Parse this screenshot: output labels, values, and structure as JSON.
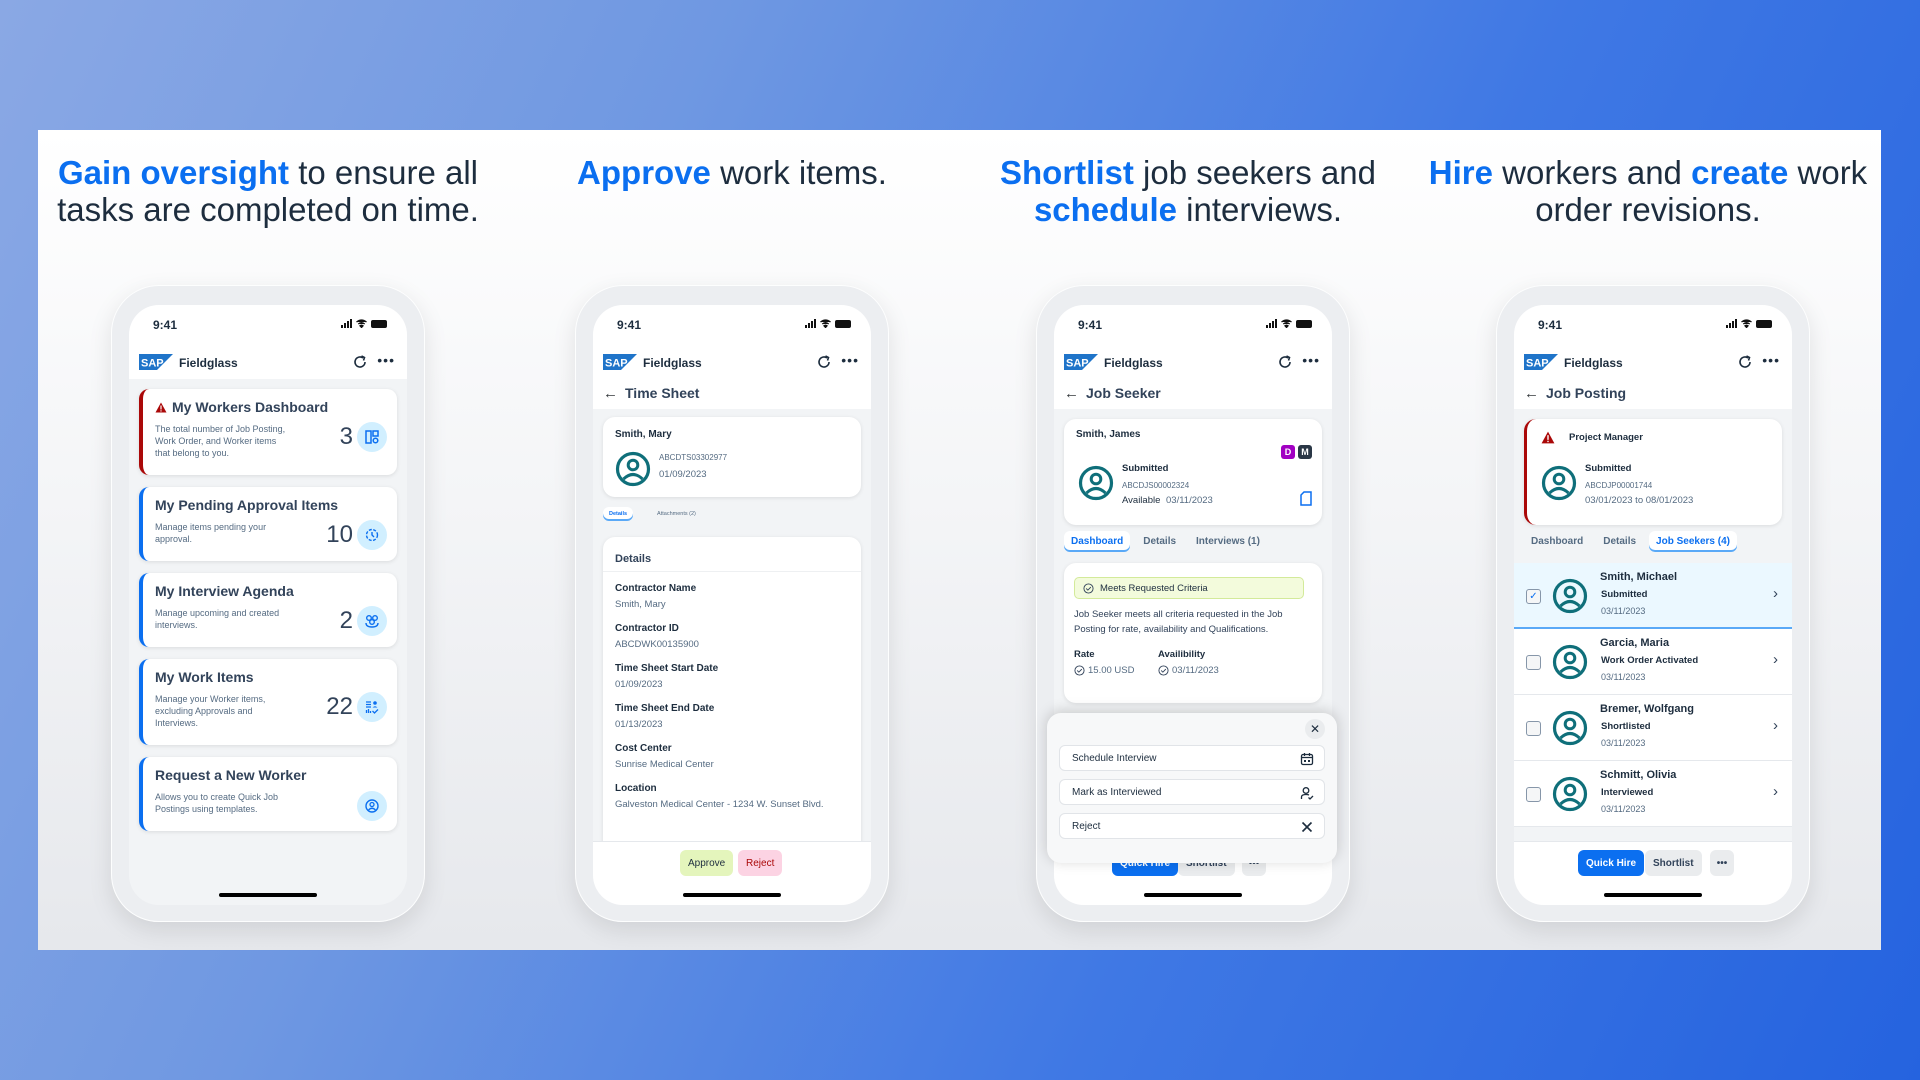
{
  "colors": {
    "accent": "#0b6ff0",
    "alert": "#aa0808",
    "avatar": "#0f6f7a"
  },
  "columns": [
    {
      "headline": {
        "highlight1": "Gain oversight",
        "rest1": " to ensure all tasks are completed on time."
      }
    },
    {
      "headline": {
        "highlight1": "Approve",
        "rest1": " work items."
      }
    },
    {
      "headline": {
        "highlight1": "Shortlist",
        "rest1": " job seekers and ",
        "highlight2": "schedule",
        "rest2": " interviews."
      }
    },
    {
      "headline": {
        "highlight1": "Hire",
        "rest1": " workers and ",
        "highlight2": "create",
        "rest2": " work order revisions."
      }
    }
  ],
  "common": {
    "time": "9:41",
    "app_name": "Fieldglass",
    "logo": "SAP",
    "more": "•••",
    "back": "←"
  },
  "phone1": {
    "cards": [
      {
        "title": "My Workers Dashboard",
        "desc": "The total number of Job Posting, Work Order, and Worker items that belong to you.",
        "count": "3",
        "icon": "dashboard-icon",
        "alert": true
      },
      {
        "title": "My Pending Approval Items",
        "desc": "Manage items pending your approval.",
        "count": "10",
        "icon": "pending-clock-icon"
      },
      {
        "title": "My Interview Agenda",
        "desc": "Manage upcoming and created interviews.",
        "count": "2",
        "icon": "people-group-icon"
      },
      {
        "title": "My Work Items",
        "desc": "Manage your Worker items, excluding Approvals and Interviews.",
        "count": "22",
        "icon": "work-items-icon"
      },
      {
        "title": "Request a New Worker",
        "desc": "Allows you to create Quick Job Postings using templates.",
        "count": "",
        "icon": "person-icon"
      }
    ]
  },
  "phone2": {
    "title": "Time Sheet",
    "header": {
      "name": "Smith, Mary",
      "id": "ABCDTS03302977",
      "date": "01/09/2023"
    },
    "tabs": [
      "Details",
      "Attachments (2)"
    ],
    "details_title": "Details",
    "fields": [
      {
        "label": "Contractor Name",
        "value": "Smith, Mary"
      },
      {
        "label": "Contractor ID",
        "value": "ABCDWK00135900"
      },
      {
        "label": "Time Sheet Start Date",
        "value": "01/09/2023"
      },
      {
        "label": "Time Sheet End Date",
        "value": "01/13/2023"
      },
      {
        "label": "Cost Center",
        "value": "Sunrise Medical Center"
      },
      {
        "label": "Location",
        "value": "Galveston Medical Center - 1234 W. Sunset Blvd."
      }
    ],
    "buttons": {
      "approve": "Approve",
      "reject": "Reject"
    }
  },
  "phone3": {
    "title": "Job Seeker",
    "header": {
      "name": "Smith, James",
      "status": "Submitted",
      "id": "ABCDJS00002324",
      "available_label": "Available",
      "available_date": "03/11/2023",
      "chips": [
        {
          "text": "D",
          "color": "#a100c2"
        },
        {
          "text": "M",
          "color": "#1d2d3e"
        }
      ]
    },
    "tabs": [
      "Dashboard",
      "Details",
      "Interviews (1)"
    ],
    "criteria": "Meets Requested Criteria",
    "criteria_desc": "Job Seeker meets all criteria requested in the Job Posting for rate, availability and Qualifications.",
    "rate_label": "Rate",
    "rate_value": "15.00 USD",
    "avail_label": "Availibility",
    "avail_value": "03/11/2023",
    "sheet_items": [
      {
        "label": "Schedule Interview",
        "icon": "calendar-icon"
      },
      {
        "label": "Mark as Interviewed",
        "icon": "person-check-icon"
      },
      {
        "label": "Reject",
        "icon": "close-icon"
      }
    ],
    "close": "✕",
    "buttons": {
      "quick_hire": "Quick Hire",
      "shortlist": "Shortlist",
      "more": "•••"
    }
  },
  "phone4": {
    "title": "Job Posting",
    "header": {
      "role": "Project Manager",
      "status": "Submitted",
      "id": "ABCDJP00001744",
      "dates": "03/01/2023 to 08/01/2023"
    },
    "tabs": [
      "Dashboard",
      "Details",
      "Job Seekers (4)"
    ],
    "seekers": [
      {
        "name": "Smith, Michael",
        "status": "Submitted",
        "date": "03/11/2023",
        "checked": true
      },
      {
        "name": "Garcia, Maria",
        "status": "Work Order Activated",
        "date": "03/11/2023",
        "checked": false
      },
      {
        "name": "Bremer, Wolfgang",
        "status": "Shortlisted",
        "date": "03/11/2023",
        "checked": false
      },
      {
        "name": "Schmitt, Olivia",
        "status": "Interviewed",
        "date": "03/11/2023",
        "checked": false
      }
    ],
    "buttons": {
      "quick_hire": "Quick Hire",
      "shortlist": "Shortlist",
      "more": "•••"
    }
  }
}
